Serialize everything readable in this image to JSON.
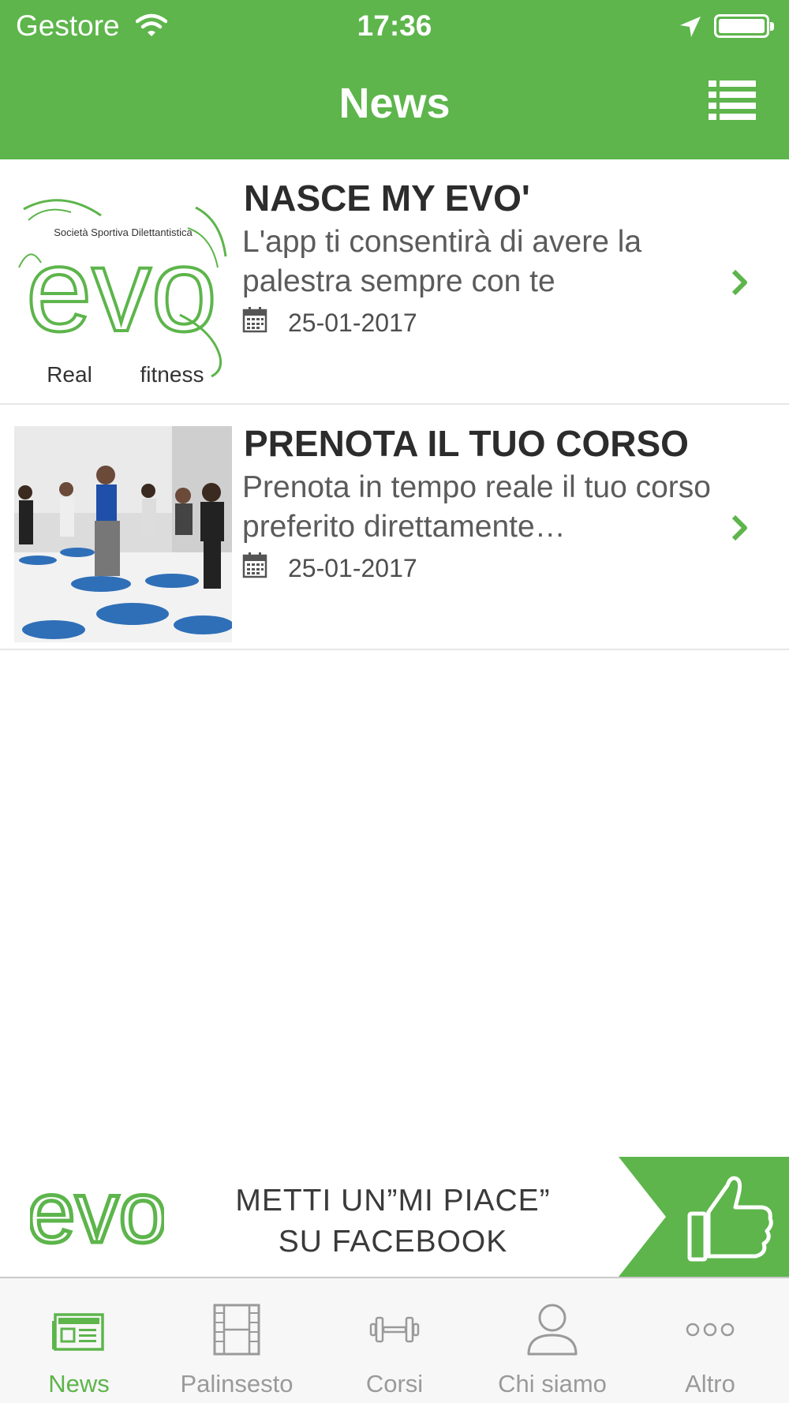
{
  "status_bar": {
    "carrier": "Gestore",
    "time": "17:36"
  },
  "header": {
    "title": "News",
    "menu_icon": "list-icon"
  },
  "news": [
    {
      "title": "NASCE MY EVO'",
      "description": "L'app ti consentirà di avere la palestra sempre con te",
      "date": "25-01-2017",
      "thumb_logo": {
        "tagline": "Società Sportiva Dilettantistica",
        "brand": "evo",
        "left_word": "Real",
        "right_word": "fitness"
      }
    },
    {
      "title": "PRENOTA IL TUO CORSO",
      "description": "Prenota in tempo reale il tuo corso preferito direttamente…",
      "date": "25-01-2017"
    }
  ],
  "banner": {
    "logo_text": "evo",
    "line1": "METTI UN”MI PIACE”",
    "line2": "SU FACEBOOK"
  },
  "tabs": [
    {
      "label": "News",
      "icon": "newspaper-icon",
      "active": true
    },
    {
      "label": "Palinsesto",
      "icon": "film-icon",
      "active": false
    },
    {
      "label": "Corsi",
      "icon": "dumbbell-icon",
      "active": false
    },
    {
      "label": "Chi siamo",
      "icon": "person-icon",
      "active": false
    },
    {
      "label": "Altro",
      "icon": "more-icon",
      "active": false
    }
  ],
  "colors": {
    "brand_green": "#5db54b",
    "inactive_gray": "#9a9a9a"
  }
}
